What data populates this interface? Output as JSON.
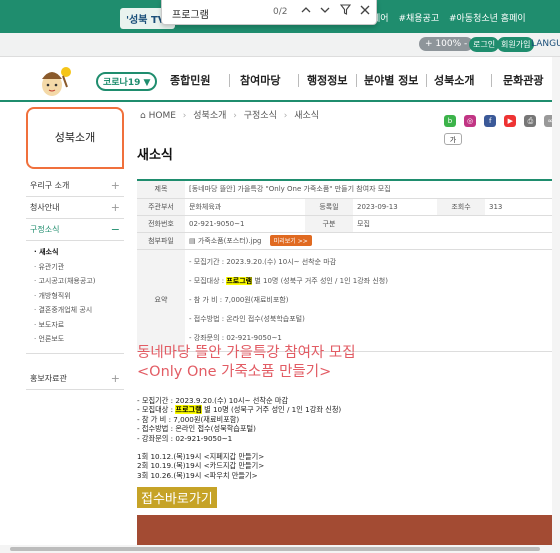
{
  "topbar": {
    "tv_label": "'성북 TV'",
    "tag_links": [
      "#채용공고",
      "#아동청소년 홈페이"
    ],
    "tag_prefix": "에어"
  },
  "findbar": {
    "query": "프로그램",
    "count": "0/2"
  },
  "utilbar": {
    "zoom": "+ 100% -",
    "login": "로그인",
    "join": "회원가입",
    "lang": "LANGU"
  },
  "header": {
    "corona": "코로나19 ▼",
    "nav": [
      "종합민원",
      "참여마당",
      "행정정보",
      "분야별 정보",
      "성북소개",
      "문화관광"
    ]
  },
  "lnb": {
    "title": "성북소개",
    "items": [
      {
        "label": "우리구 소개",
        "sign": "+"
      },
      {
        "label": "청사안내",
        "sign": "+"
      },
      {
        "label": "구정소식",
        "sign": "−"
      }
    ],
    "sub": [
      "새소식",
      "유관기관",
      "고시공고(채용공고)",
      "개방형직위",
      "결혼중개업체 공시",
      "보도자료",
      "언론보도"
    ],
    "last": {
      "label": "홍보자료관",
      "sign": "+"
    }
  },
  "breadcrumb": [
    "HOME",
    "성북소개",
    "구정소식",
    "새소식"
  ],
  "page_title": "새소식",
  "info": {
    "title_label": "제목",
    "title_value": "[동네마당 뜰안] 가을특강 \"Only One 가죽소품\" 만들기 참여자 모집",
    "dept_label": "주관부서",
    "dept_value": "문화체육과",
    "date_label": "등록일",
    "date_value": "2023-09-13",
    "views_label": "조회수",
    "views_value": "313",
    "phone_label": "전화번호",
    "phone_value": "02-921-9050~1",
    "type_label": "구분",
    "type_value": "모집",
    "file_label": "첨부파일",
    "file_name": "가죽소품(포스터).jpg",
    "file_btn": "미리보기 >>",
    "summary_label": "요약",
    "summary": [
      "- 모집기간 : 2023.9.20.(수) 10시~ 선착순 마감",
      "- 모집대상 :",
      "- 참 가 비 : 7,000원(재료비포함)",
      "- 접수방법 : 온라인 접수(성북학습포털)",
      "- 강좌문의 : 02-921-9050~1"
    ],
    "summary_hl": "프로그램",
    "summary_tail": " 별 10명 (성북구 거주 성인 / 1인 1강좌 신청)"
  },
  "headline": [
    "동네마당 뜰안 가을특강 참여자 모집",
    "<Only One 가죽소품 만들기>"
  ],
  "body": {
    "l1": "- 모집기간 : 2023.9.20.(수) 10시~ 선착순 마감",
    "l2a": "- 모집대상 : ",
    "l2hl": "프로그램",
    "l2b": " 별 10명 (성북구 거주 성인 / 1인 1강좌 신청)",
    "l3": "- 참 가 비 : 7,000원(재료비포함)",
    "l4": "- 접수방법 : 온라인 접수(성북학습포털)",
    "l5": "- 강좌문의 : 02-921-9050~1",
    "s1": "1회 10.12.(목)19시 <지폐지갑 만들기>",
    "s2": "2회 10.19.(목)19시 <카드지갑 만들기>",
    "s3": "3회 10.26.(목)19시 <파우치 만들기>"
  },
  "cta": "접수바로가기"
}
